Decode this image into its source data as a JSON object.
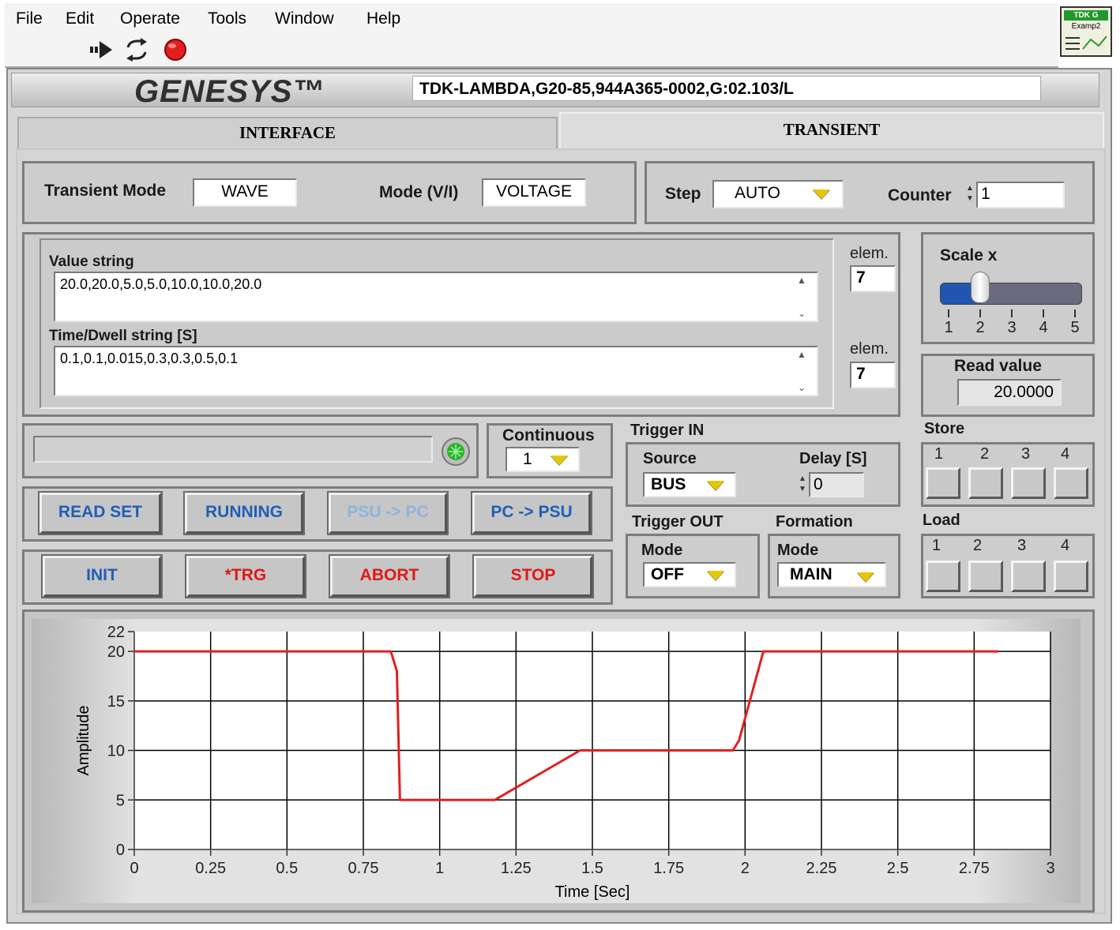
{
  "menu": {
    "items": [
      "File",
      "Edit",
      "Operate",
      "Tools",
      "Window",
      "Help"
    ]
  },
  "toolbar": {
    "icons": [
      "run-arrow-icon",
      "run-continuous-icon",
      "abort-stop-icon"
    ]
  },
  "app_icon": {
    "line1": "TDK G",
    "line2": "Examp2"
  },
  "header": {
    "logo": "GENESYS™",
    "id_string": "TDK-LAMBDA,G20-85,944A365-0002,G:02.103/L"
  },
  "tabs": [
    {
      "label": "INTERFACE",
      "active": false
    },
    {
      "label": "TRANSIENT",
      "active": true
    }
  ],
  "transient": {
    "mode_label": "Transient Mode",
    "mode_value": "WAVE",
    "vi_label": "Mode (V/I)",
    "vi_value": "VOLTAGE",
    "step_label": "Step",
    "step_value": "AUTO",
    "counter_label": "Counter",
    "counter_value": "1"
  },
  "strings": {
    "value_label": "Value string",
    "value_text": "20.0,20.0,5.0,5.0,10.0,10.0,20.0",
    "time_label": "Time/Dwell string [S]",
    "time_text": "0.1,0.1,0.015,0.3,0.3,0.5,0.1",
    "elem_label": "elem.",
    "value_elem": "7",
    "time_elem": "7"
  },
  "scale": {
    "label": "Scale x",
    "ticks": [
      "1",
      "2",
      "3",
      "4",
      "5"
    ],
    "value": 2
  },
  "read_value": {
    "label": "Read value",
    "value": "20.0000"
  },
  "status": {
    "text": "",
    "led_color": "#28b428"
  },
  "continuous": {
    "label": "Continuous",
    "value": "1"
  },
  "trigger_in": {
    "title": "Trigger IN",
    "source_label": "Source",
    "source_value": "BUS",
    "delay_label": "Delay [S]",
    "delay_value": "0"
  },
  "trigger_out": {
    "title": "Trigger OUT",
    "mode_label": "Mode",
    "mode_value": "OFF"
  },
  "formation": {
    "title": "Formation",
    "mode_label": "Mode",
    "mode_value": "MAIN"
  },
  "store": {
    "title": "Store",
    "slots": [
      "1",
      "2",
      "3",
      "4"
    ]
  },
  "load": {
    "title": "Load",
    "slots": [
      "1",
      "2",
      "3",
      "4"
    ]
  },
  "buttons": {
    "read_set": "READ SET",
    "running": "RUNNING",
    "psu_pc": "PSU -> PC",
    "pc_psu": "PC -> PSU",
    "init": "INIT",
    "trg": "*TRG",
    "abort": "ABORT",
    "stop": "STOP"
  },
  "chart_data": {
    "type": "line",
    "xlabel": "Time [Sec]",
    "ylabel": "Amplitude",
    "xlim": [
      0,
      3
    ],
    "ylim": [
      0,
      22
    ],
    "xticks": [
      "0",
      "0.25",
      "0.5",
      "0.75",
      "1",
      "1.25",
      "1.5",
      "1.75",
      "2",
      "2.25",
      "2.5",
      "2.75",
      "3"
    ],
    "yticks": [
      "0",
      "5",
      "10",
      "15",
      "20",
      "22"
    ],
    "grid": true,
    "series": [
      {
        "color": "#e02020",
        "x": [
          0.0,
          0.84,
          0.86,
          0.87,
          1.18,
          1.46,
          1.96,
          1.98,
          2.06,
          2.83
        ],
        "y": [
          20,
          20,
          18,
          5,
          5,
          10,
          10,
          11,
          20,
          20
        ]
      }
    ]
  }
}
